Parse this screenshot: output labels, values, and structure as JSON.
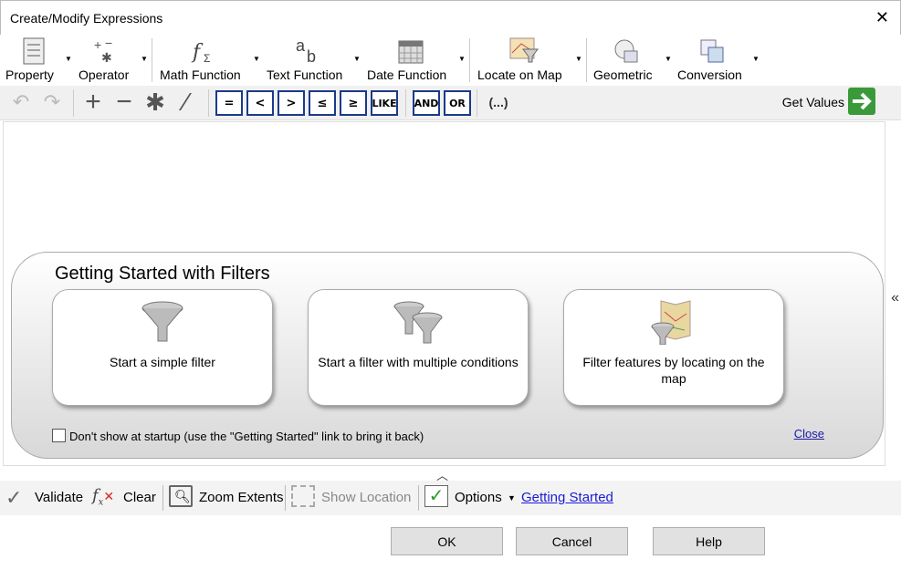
{
  "window": {
    "title": "Create/Modify Expressions"
  },
  "ribbon": {
    "property": "Property",
    "operator": "Operator",
    "math": "Math Function",
    "text": "Text Function",
    "date": "Date Function",
    "locate": "Locate on Map",
    "geometric": "Geometric",
    "conversion": "Conversion"
  },
  "toolbar": {
    "eq": "=",
    "lt": "<",
    "gt": ">",
    "le": "≤",
    "ge": "≥",
    "like": "LIKE",
    "and": "AND",
    "or": "OR",
    "paren": "(...)",
    "get_values": "Get Values"
  },
  "getting_started": {
    "title": "Getting Started with Filters",
    "cards": [
      {
        "label": "Start a simple filter"
      },
      {
        "label": "Start a filter with multiple conditions"
      },
      {
        "label": "Filter features by locating on the map"
      }
    ],
    "dont_show": "Don't show at startup (use the \"Getting Started\" link to bring it back)",
    "close": "Close"
  },
  "bottom": {
    "validate": "Validate",
    "clear": "Clear",
    "zoom": "Zoom Extents",
    "show_location": "Show Location",
    "options": "Options",
    "getting_started": "Getting Started"
  },
  "buttons": {
    "ok": "OK",
    "cancel": "Cancel",
    "help": "Help"
  }
}
